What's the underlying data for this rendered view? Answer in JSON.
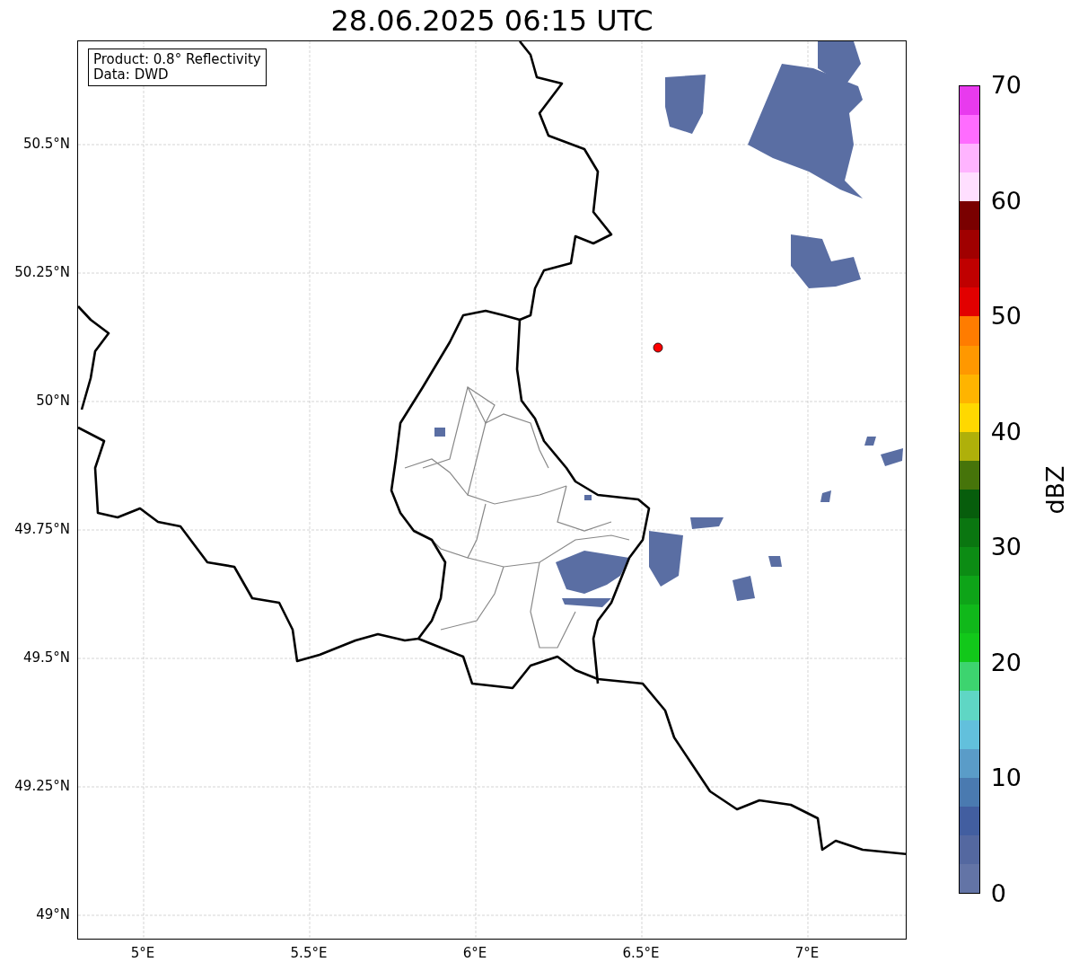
{
  "title": "28.06.2025 06:15 UTC",
  "info_box": {
    "lines": [
      "Product: 0.8° Reflectivity",
      "Data: DWD"
    ]
  },
  "map": {
    "xticks": [
      "5°E",
      "5.5°E",
      "6°E",
      "6.5°E",
      "7°E"
    ],
    "yticks": [
      "50.5°N",
      "50.25°N",
      "50°N",
      "49.75°N",
      "49.5°N",
      "49.25°N",
      "49°N"
    ]
  },
  "colorbar": {
    "label": "dBZ",
    "ticks": [
      "70",
      "60",
      "50",
      "40",
      "30",
      "20",
      "10",
      "0"
    ],
    "bins": [
      {
        "color": "#6374a6"
      },
      {
        "color": "#5468a0"
      },
      {
        "color": "#425ea0"
      },
      {
        "color": "#4a7ab0"
      },
      {
        "color": "#5a9cc8"
      },
      {
        "color": "#62c0dc"
      },
      {
        "color": "#5fd6c4"
      },
      {
        "color": "#3dd46f"
      },
      {
        "color": "#12c81a"
      },
      {
        "color": "#10b81a"
      },
      {
        "color": "#0ea418"
      },
      {
        "color": "#0c8c14"
      },
      {
        "color": "#0a7610"
      },
      {
        "color": "#075d0c"
      },
      {
        "color": "#46740a"
      },
      {
        "color": "#afb00a"
      },
      {
        "color": "#ffd800"
      },
      {
        "color": "#ffb400"
      },
      {
        "color": "#ff9800"
      },
      {
        "color": "#ff7c00"
      },
      {
        "color": "#e20000"
      },
      {
        "color": "#c00000"
      },
      {
        "color": "#a00000"
      },
      {
        "color": "#7a0000"
      },
      {
        "color": "#ffdfff"
      },
      {
        "color": "#ffb4ff"
      },
      {
        "color": "#ff6cff"
      },
      {
        "color": "#e83aee"
      }
    ]
  }
}
